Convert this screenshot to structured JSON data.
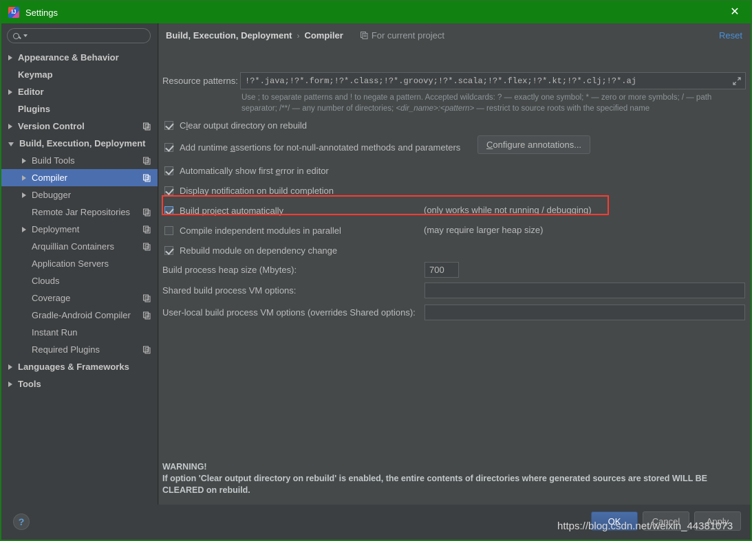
{
  "window": {
    "title": "Settings",
    "icon": "intellij-logo-icon",
    "close_label": "✕"
  },
  "sidebar": {
    "search_placeholder": "",
    "search_value": "",
    "items": [
      {
        "label": "Appearance & Behavior",
        "level": 0,
        "arrow": "right",
        "scope_icon": false,
        "selected": false
      },
      {
        "label": "Keymap",
        "level": 0,
        "arrow": "none",
        "scope_icon": false,
        "selected": false
      },
      {
        "label": "Editor",
        "level": 0,
        "arrow": "right",
        "scope_icon": false,
        "selected": false
      },
      {
        "label": "Plugins",
        "level": 0,
        "arrow": "none",
        "scope_icon": false,
        "selected": false
      },
      {
        "label": "Version Control",
        "level": 0,
        "arrow": "right",
        "scope_icon": true,
        "selected": false
      },
      {
        "label": "Build, Execution, Deployment",
        "level": 0,
        "arrow": "down",
        "scope_icon": false,
        "selected": false
      },
      {
        "label": "Build Tools",
        "level": 1,
        "arrow": "right",
        "scope_icon": true,
        "selected": false
      },
      {
        "label": "Compiler",
        "level": 1,
        "arrow": "right",
        "scope_icon": true,
        "selected": true
      },
      {
        "label": "Debugger",
        "level": 1,
        "arrow": "right",
        "scope_icon": false,
        "selected": false
      },
      {
        "label": "Remote Jar Repositories",
        "level": 1,
        "arrow": "none",
        "scope_icon": true,
        "selected": false
      },
      {
        "label": "Deployment",
        "level": 1,
        "arrow": "right",
        "scope_icon": true,
        "selected": false
      },
      {
        "label": "Arquillian Containers",
        "level": 1,
        "arrow": "none",
        "scope_icon": true,
        "selected": false
      },
      {
        "label": "Application Servers",
        "level": 1,
        "arrow": "none",
        "scope_icon": false,
        "selected": false
      },
      {
        "label": "Clouds",
        "level": 1,
        "arrow": "none",
        "scope_icon": false,
        "selected": false
      },
      {
        "label": "Coverage",
        "level": 1,
        "arrow": "none",
        "scope_icon": true,
        "selected": false
      },
      {
        "label": "Gradle-Android Compiler",
        "level": 1,
        "arrow": "none",
        "scope_icon": true,
        "selected": false
      },
      {
        "label": "Instant Run",
        "level": 1,
        "arrow": "none",
        "scope_icon": false,
        "selected": false
      },
      {
        "label": "Required Plugins",
        "level": 1,
        "arrow": "none",
        "scope_icon": true,
        "selected": false
      },
      {
        "label": "Languages & Frameworks",
        "level": 0,
        "arrow": "right",
        "scope_icon": false,
        "selected": false
      },
      {
        "label": "Tools",
        "level": 0,
        "arrow": "right",
        "scope_icon": false,
        "selected": false
      }
    ]
  },
  "panel": {
    "breadcrumb_root": "Build, Execution, Deployment",
    "breadcrumb_sep": "›",
    "breadcrumb_leaf": "Compiler",
    "scope_note": "For current project",
    "reset_label": "Reset",
    "resource_patterns": {
      "label": "Resource patterns:",
      "value": "!?*.java;!?*.form;!?*.class;!?*.groovy;!?*.scala;!?*.flex;!?*.kt;!?*.clj;!?*.aj",
      "expand_icon": "expand-icon"
    },
    "hint_line1": "Use ; to separate patterns and ! to negate a pattern. Accepted wildcards: ? — exactly one symbol; * — zero or more symbols; / — path",
    "hint_line2a": "separator; /**/ — any number of directories;  ",
    "hint_line2b": "<dir_name>:<pattern>",
    "hint_line2c": " — restrict to source roots with the specified name",
    "checkboxes": [
      {
        "label_pre": "C",
        "label_mn": "l",
        "label_post": "ear output directory on rebuild",
        "checked": true,
        "focused": false,
        "note": ""
      },
      {
        "label_pre": "Add runtime ",
        "label_mn": "a",
        "label_post": "ssertions for not-null-annotated methods and parameters",
        "checked": true,
        "focused": false,
        "note": ""
      },
      {
        "label_pre": "Automatically show first ",
        "label_mn": "e",
        "label_post": "rror in editor",
        "checked": true,
        "focused": false,
        "note": ""
      },
      {
        "label_pre": "Display notification on build completion",
        "label_mn": "",
        "label_post": "",
        "checked": true,
        "focused": false,
        "note": ""
      },
      {
        "label_pre": "Build project automatically",
        "label_mn": "",
        "label_post": "",
        "checked": true,
        "focused": true,
        "note": "(only works while not running / debugging)"
      },
      {
        "label_pre": "Compile independent modules in parallel",
        "label_mn": "",
        "label_post": "",
        "checked": false,
        "focused": false,
        "note": "(may require larger heap size)"
      },
      {
        "label_pre": "Rebuild module on dependency change",
        "label_mn": "",
        "label_post": "",
        "checked": true,
        "focused": false,
        "note": ""
      }
    ],
    "configure_annotations": {
      "pre": "C",
      "mn": "",
      "post": "onfigure annotations..."
    },
    "fields": [
      {
        "label": "Build process heap size (Mbytes):",
        "value": "700"
      },
      {
        "label": "Shared build process VM options:",
        "value": ""
      },
      {
        "label": "User-local build process VM options (overrides Shared options):",
        "value": ""
      }
    ],
    "warning_title": "WARNING!",
    "warning_body": "If option 'Clear output directory on rebuild' is enabled, the entire contents of directories where generated sources are stored WILL BE CLEARED on rebuild."
  },
  "bottom": {
    "help_label": "?",
    "ok_label": "OK",
    "cancel_label": "Cancel",
    "apply_label": "Apply"
  },
  "watermark": "https://blog.csdn.net/weixin_44381073",
  "colors": {
    "titlebar": "#118211",
    "sidebar_bg": "#3c3f41",
    "panel_bg": "#45494a",
    "selection": "#4b6eaf",
    "link": "#4a90d9",
    "annotation_red": "#ff3b30",
    "default_button": "#4a6ea8"
  }
}
